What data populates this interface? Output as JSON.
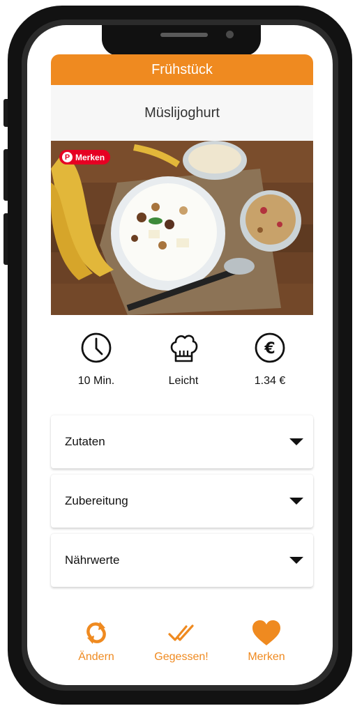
{
  "header": {
    "category": "Frühstück",
    "recipe_title": "Müslijoghurt"
  },
  "photo": {
    "pinterest_label": "Merken",
    "pinterest_icon": "pinterest-icon",
    "subject": "bowl of yogurt with muesli and bananas"
  },
  "info": [
    {
      "icon": "clock-icon",
      "label": "10 Min."
    },
    {
      "icon": "chef-hat-icon",
      "label": "Leicht"
    },
    {
      "icon": "euro-icon",
      "label": "1.34 €"
    }
  ],
  "sections": [
    {
      "title": "Zutaten",
      "icon": "chevron-down-icon"
    },
    {
      "title": "Zubereitung",
      "icon": "chevron-down-icon"
    },
    {
      "title": "Nährwerte",
      "icon": "chevron-down-icon"
    }
  ],
  "actions": [
    {
      "icon": "refresh-icon",
      "label": "Ändern"
    },
    {
      "icon": "double-check-icon",
      "label": "Gegessen!"
    },
    {
      "icon": "heart-icon",
      "label": "Merken"
    }
  ],
  "colors": {
    "accent": "#ef8a20",
    "pinterest": "#e60023"
  }
}
